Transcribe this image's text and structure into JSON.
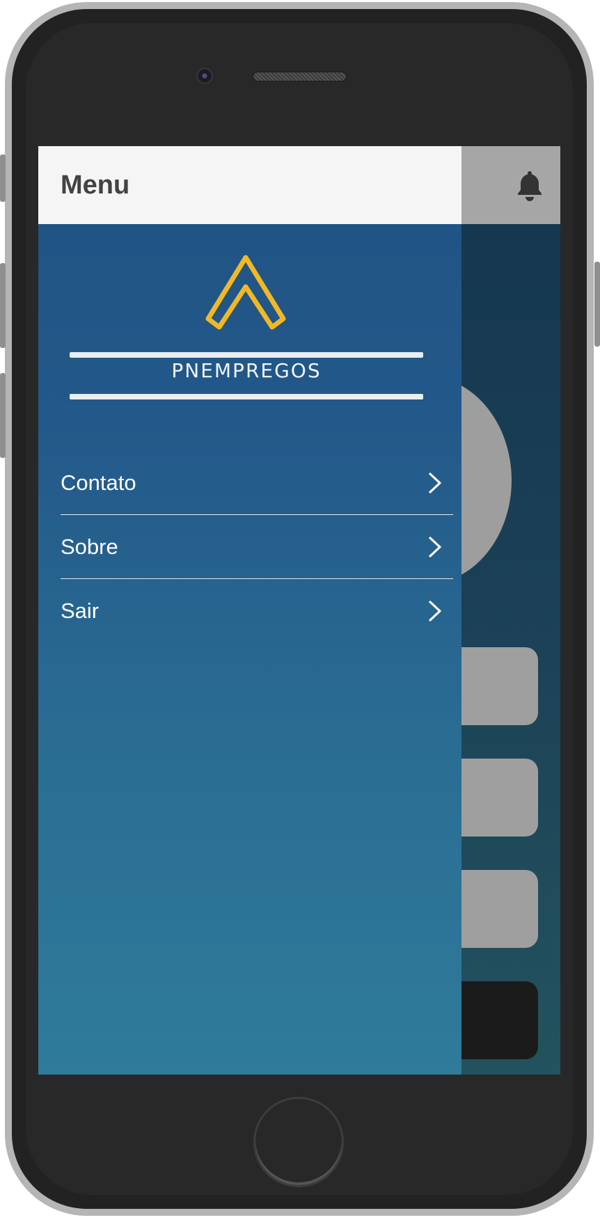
{
  "drawer": {
    "title": "Menu",
    "logo": {
      "text": "PNEMPREGOS",
      "accent_color": "#f2b824"
    },
    "items": [
      {
        "label": "Contato",
        "icon": "chevron-right-icon"
      },
      {
        "label": "Sobre",
        "icon": "chevron-right-icon"
      },
      {
        "label": "Sair",
        "icon": "chevron-right-icon"
      }
    ]
  },
  "header": {
    "icon": "bell-icon"
  },
  "colors": {
    "drawer_gradient_top": "#1f5283",
    "drawer_gradient_bottom": "#2f7b9b",
    "drawer_header_bg": "#f5f5f5",
    "underlay_header_bg": "#a6a6a6"
  }
}
